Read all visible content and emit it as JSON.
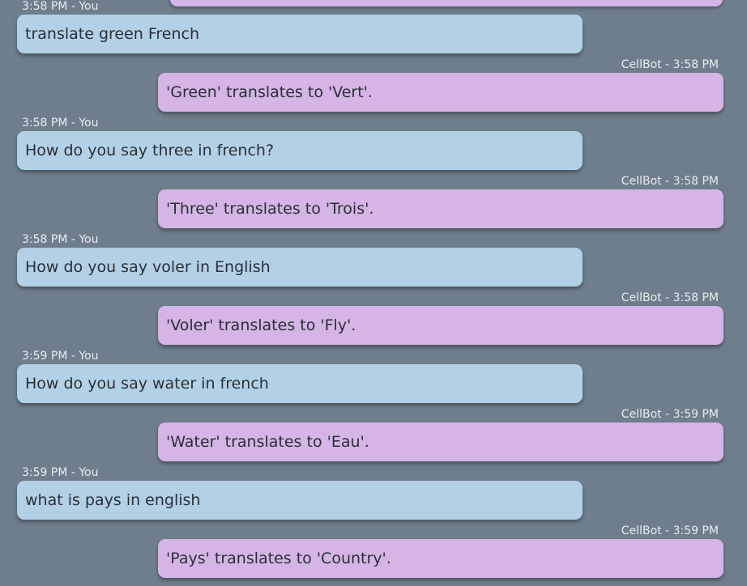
{
  "messages": [
    {
      "sender": "user",
      "meta": "3:58 PM - You",
      "text": "translate green French"
    },
    {
      "sender": "bot",
      "meta": "CellBot - 3:58 PM",
      "text": "'Green' translates to 'Vert'."
    },
    {
      "sender": "user",
      "meta": "3:58 PM - You",
      "text": "How do you say three in french?"
    },
    {
      "sender": "bot",
      "meta": "CellBot - 3:58 PM",
      "text": "'Three' translates to 'Trois'."
    },
    {
      "sender": "user",
      "meta": "3:58 PM - You",
      "text": "How do you say voler in English"
    },
    {
      "sender": "bot",
      "meta": "CellBot - 3:58 PM",
      "text": "'Voler' translates to 'Fly'."
    },
    {
      "sender": "user",
      "meta": "3:59 PM - You",
      "text": "How do you say water in french"
    },
    {
      "sender": "bot",
      "meta": "CellBot - 3:59 PM",
      "text": "'Water' translates to 'Eau'."
    },
    {
      "sender": "user",
      "meta": "3:59 PM - You",
      "text": "what is pays in english"
    },
    {
      "sender": "bot",
      "meta": "CellBot - 3:59 PM",
      "text": "'Pays' translates to 'Country'."
    }
  ],
  "colors": {
    "background": "#6f7e8c",
    "user_bubble": "#b3d1e6",
    "bot_bubble": "#d4b5e5",
    "meta_text": "#e8ecef",
    "message_text": "#2a2f36"
  }
}
